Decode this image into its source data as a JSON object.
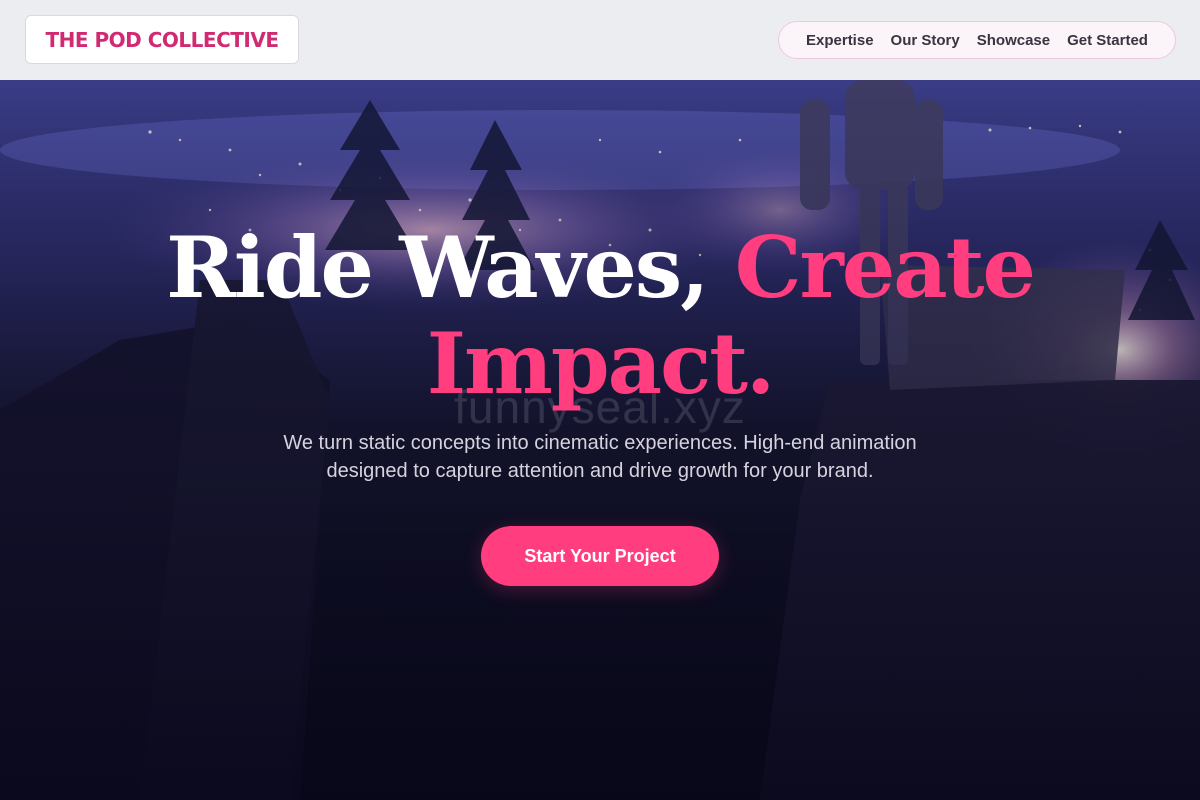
{
  "header": {
    "logo_text": "THE POD COLLECTIVE",
    "nav": [
      {
        "label": "Expertise"
      },
      {
        "label": "Our Story"
      },
      {
        "label": "Showcase"
      },
      {
        "label": "Get Started"
      }
    ]
  },
  "hero": {
    "headline_part1": "Ride Waves, ",
    "headline_part2": "Create Impact.",
    "subtitle_line1": "We turn static concepts into cinematic experiences. High-end animation",
    "subtitle_line2": "designed to capture attention and drive growth for your brand.",
    "cta_label": "Start Your Project",
    "watermark": "funnyseal.xyz"
  },
  "colors": {
    "accent": "#ff3d7f",
    "logo": "#d12a72",
    "header_bg": "#ecedf1",
    "hero_bg": "#0c0b1c"
  }
}
